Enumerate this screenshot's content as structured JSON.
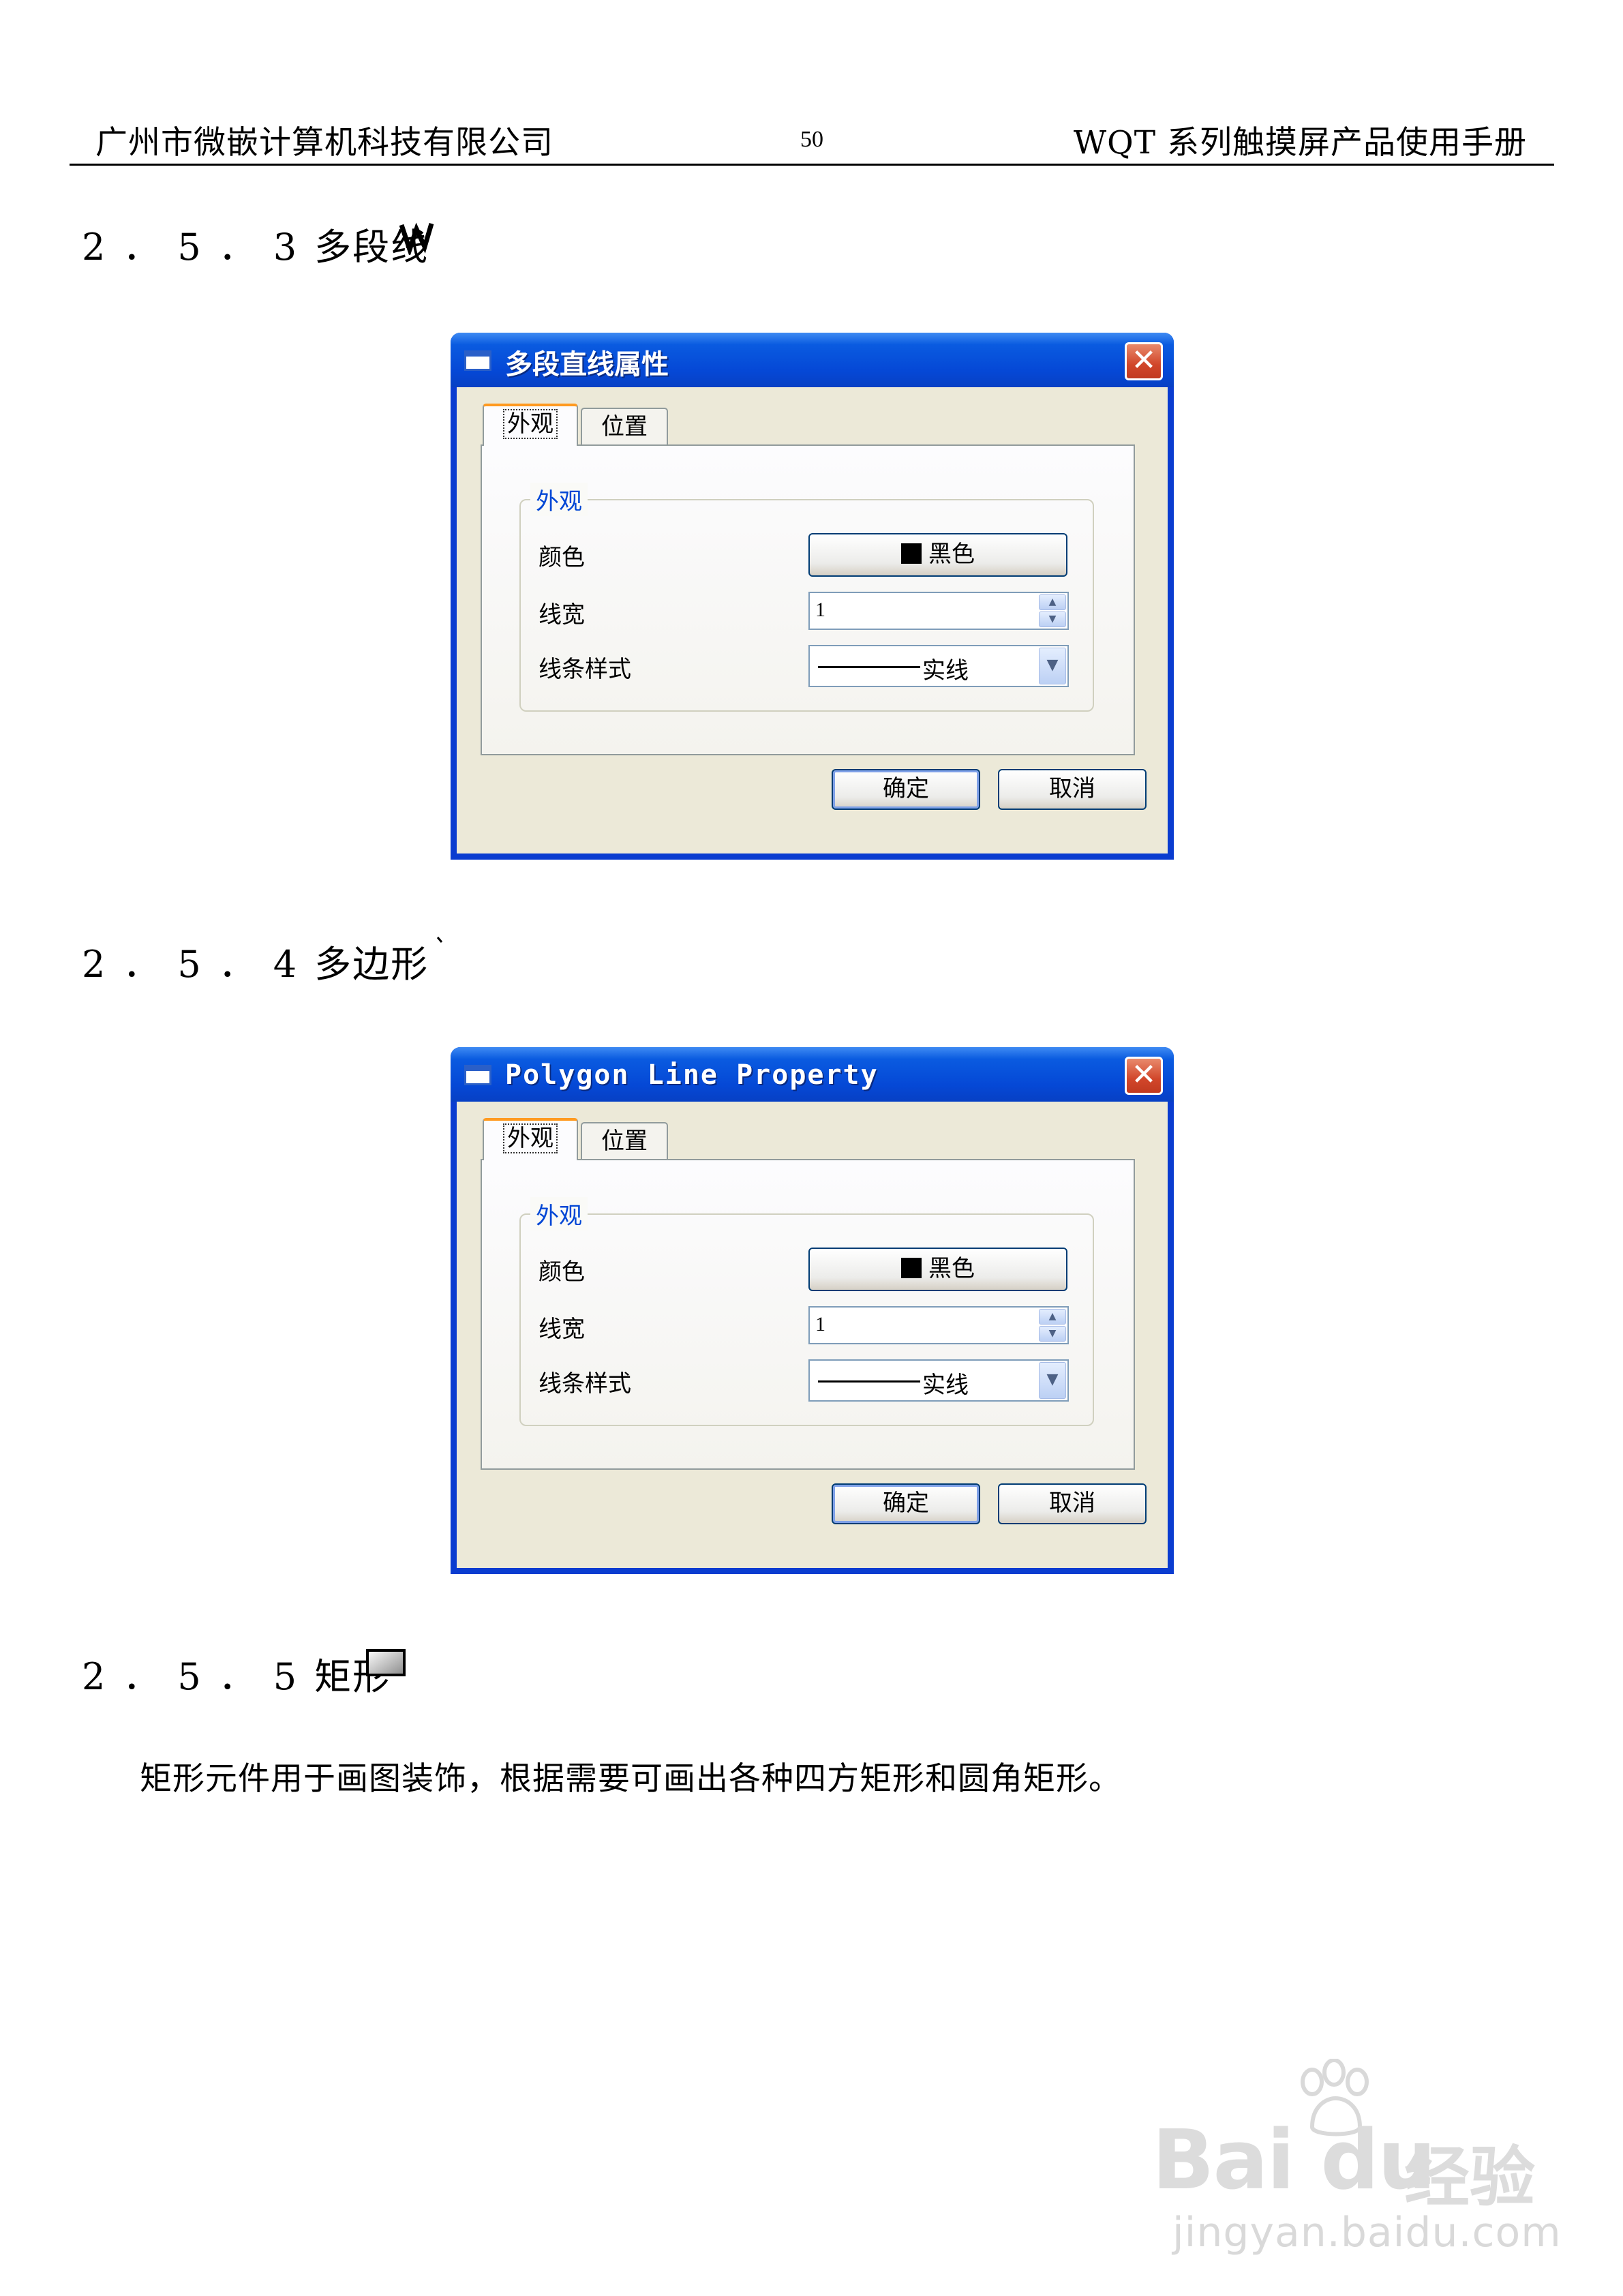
{
  "header": {
    "company": "广州市微嵌计算机科技有限公司",
    "page_number": "50",
    "manual_title": "WQT 系列触摸屏产品使用手册"
  },
  "sections": [
    {
      "number": "2．5．3",
      "title": "多段线",
      "icon": "polyline-icon"
    },
    {
      "number": "2．5．4",
      "title": "多边形",
      "icon": "polygon-icon"
    },
    {
      "number": "2．5．5",
      "title": "矩形",
      "icon": "rectangle-icon"
    }
  ],
  "dialogs": [
    {
      "title": "多段直线属性",
      "close_glyph": "✕",
      "tabs": [
        "外观",
        "位置"
      ],
      "group_title": "外观",
      "color_label": "颜色",
      "color_value": "黑色",
      "width_label": "线宽",
      "width_value": "1",
      "style_label": "线条样式",
      "style_value": "实线",
      "ok_label": "确定",
      "cancel_label": "取消"
    },
    {
      "title": "Polygon Line Property",
      "close_glyph": "✕",
      "tabs": [
        "外观",
        "位置"
      ],
      "group_title": "外观",
      "color_label": "颜色",
      "color_value": "黑色",
      "width_label": "线宽",
      "width_value": "1",
      "style_label": "线条样式",
      "style_value": "实线",
      "ok_label": "确定",
      "cancel_label": "取消"
    }
  ],
  "body": {
    "rectangle_description": "矩形元件用于画图装饰，根据需要可画出各种四方矩形和圆角矩形。"
  },
  "watermark": {
    "logo": "Bai du",
    "cn": "经验",
    "url": "jingyan.baidu.com"
  },
  "colors": {
    "titlebar": "#0548d6",
    "dialog_bg": "#ece9d8",
    "group_title": "#0046d5",
    "tab_accent": "#ff9a20",
    "close_button": "#d1462a"
  }
}
